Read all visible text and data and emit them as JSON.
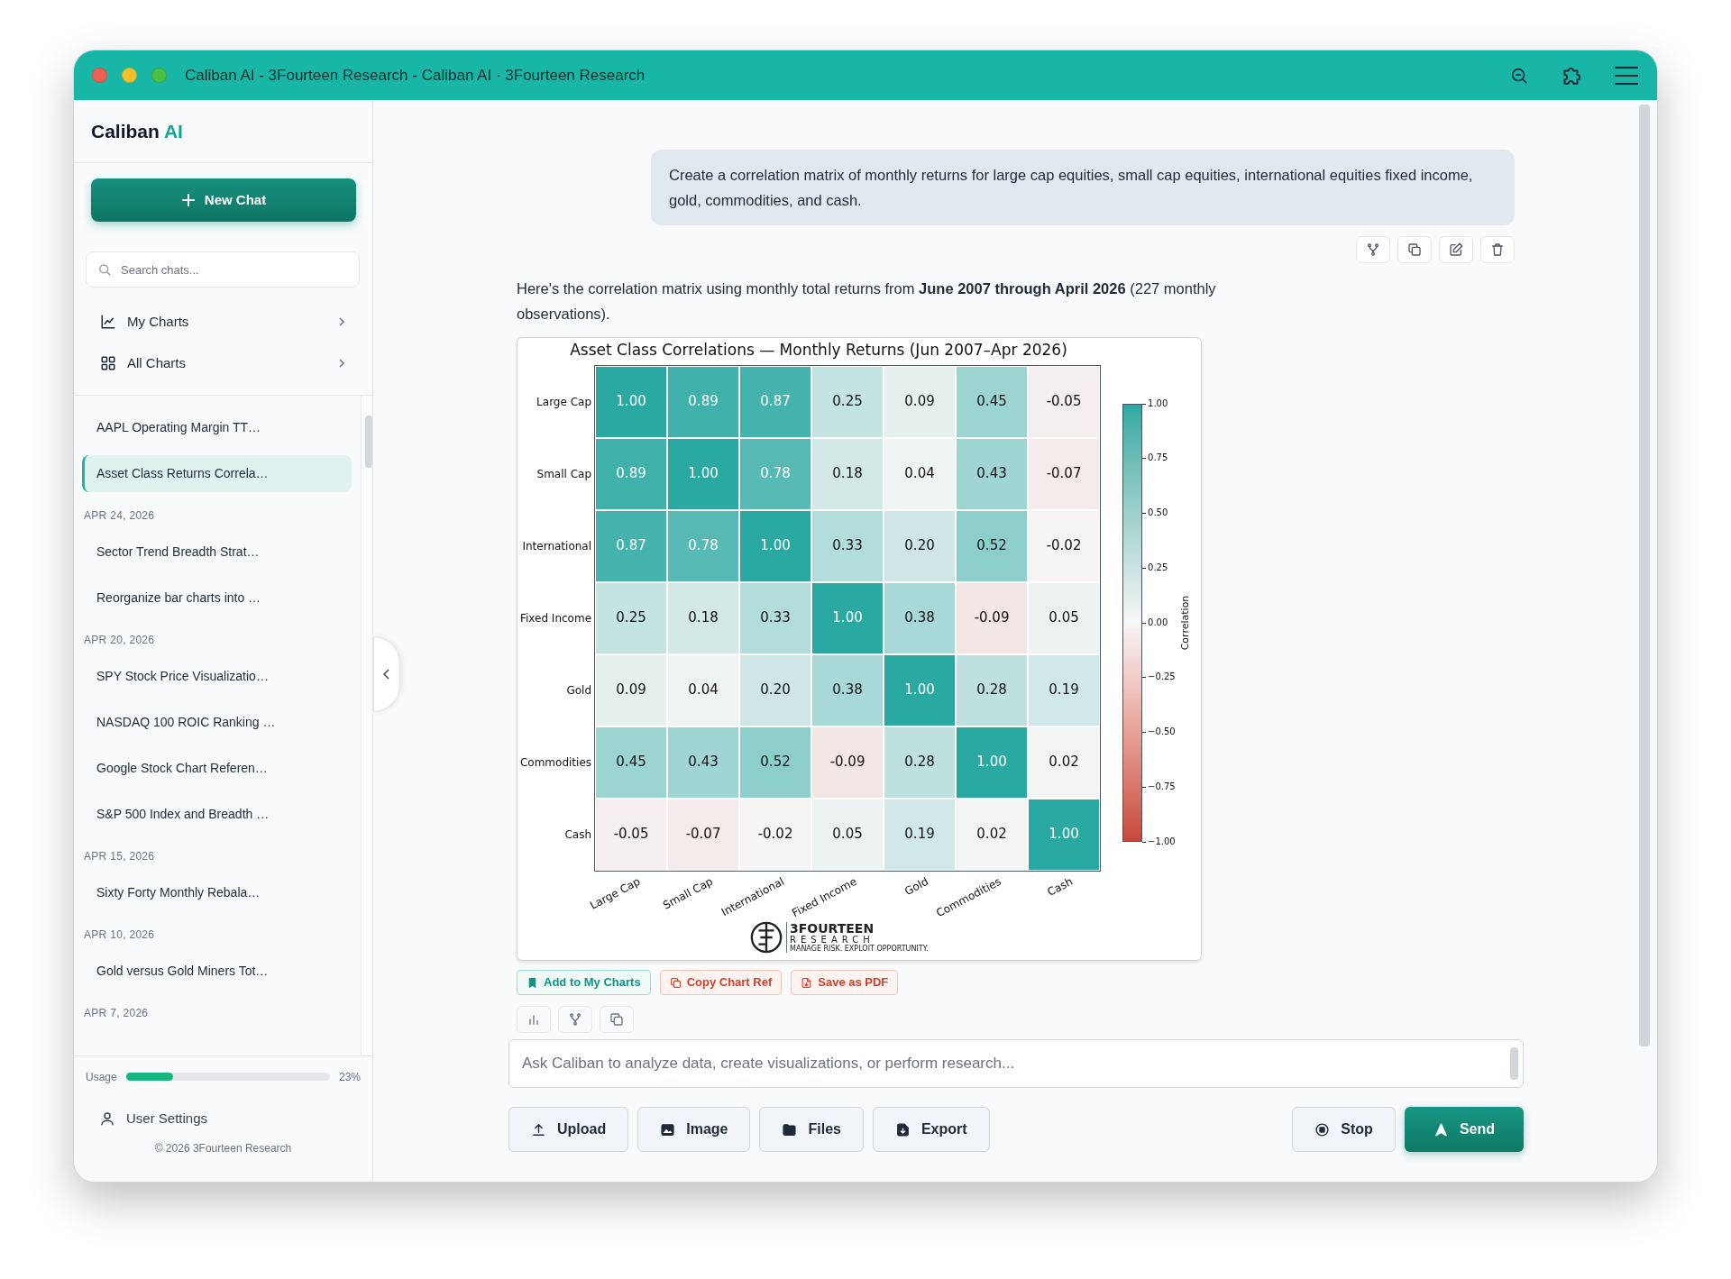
{
  "window": {
    "title": "Caliban AI - 3Fourteen Research - Caliban AI · 3Fourteen Research"
  },
  "sidebar": {
    "brand": "Caliban",
    "brand_accent": "AI",
    "new_chat": "New Chat",
    "search": {
      "placeholder": "Search chats..."
    },
    "nav": [
      {
        "label": "My Charts",
        "kind": "chart"
      },
      {
        "label": "All Charts",
        "kind": "grid"
      }
    ],
    "chat_groups": [
      {
        "items": [
          {
            "title": "AAPL Operating Margin TT…",
            "selected": false
          },
          {
            "title": "Asset Class Returns Correla…",
            "selected": true
          }
        ]
      },
      {
        "heading": "APR 24, 2026",
        "items": [
          {
            "title": "Sector Trend Breadth Strat…",
            "selected": false
          },
          {
            "title": "Reorganize bar charts into …",
            "selected": false
          }
        ]
      },
      {
        "heading": "APR 20, 2026",
        "items": [
          {
            "title": "SPY Stock Price Visualizatio…",
            "selected": false
          },
          {
            "title": "NASDAQ 100 ROIC Ranking …",
            "selected": false
          },
          {
            "title": "Google Stock Chart Referen…",
            "selected": false
          },
          {
            "title": "S&P 500 Index and Breadth …",
            "selected": false
          }
        ]
      },
      {
        "heading": "APR 15, 2026",
        "items": [
          {
            "title": "Sixty Forty Monthly Rebala…",
            "selected": false
          }
        ]
      },
      {
        "heading": "APR 10, 2026",
        "items": [
          {
            "title": "Gold versus Gold Miners Tot…",
            "selected": false
          }
        ]
      },
      {
        "heading": "APR 7, 2026"
      }
    ],
    "usage": {
      "label": "Usage",
      "level": 0.23,
      "reading": "23%"
    },
    "user_settings": "User Settings",
    "footer": "© 2026 3Fourteen Research"
  },
  "conversation": {
    "user_message": "Create a correlation matrix of monthly returns for large cap equities, small cap equities, international equities fixed income, gold, commodities, and cash.",
    "assistant_message": "Here's the correlation matrix using monthly total returns from **June 2007 through April 2026** (227 monthly observations).",
    "heatmap": {
      "title": "Asset Class Correlations — Monthly Returns (Jun 2007–Apr 2026)",
      "rows": [
        "Large Cap",
        "Small Cap",
        "International",
        "Fixed Income",
        "Gold",
        "Commodities",
        "Cash"
      ],
      "columns": [
        "Large Cap",
        "Small Cap",
        "International",
        "Fixed Income",
        "Gold",
        "Commodities",
        "Cash"
      ],
      "cells": [
        [
          "1.00",
          "0.89",
          "0.87",
          "0.25",
          "0.09",
          "0.45",
          "-0.05"
        ],
        [
          "0.89",
          "1.00",
          "0.78",
          "0.18",
          "0.04",
          "0.43",
          "-0.07"
        ],
        [
          "0.87",
          "0.78",
          "1.00",
          "0.33",
          "0.20",
          "0.52",
          "-0.02"
        ],
        [
          "0.25",
          "0.18",
          "0.33",
          "1.00",
          "0.38",
          "-0.09",
          "0.05"
        ],
        [
          "0.09",
          "0.04",
          "0.20",
          "0.38",
          "1.00",
          "0.28",
          "0.19"
        ],
        [
          "0.45",
          "0.43",
          "0.52",
          "-0.09",
          "0.28",
          "1.00",
          "0.02"
        ],
        [
          "-0.05",
          "-0.07",
          "-0.02",
          "0.05",
          "0.19",
          "0.02",
          "1.00"
        ]
      ],
      "colorbar": {
        "label": "Correlation",
        "ticks": [
          "1.00",
          "0.75",
          "0.50",
          "0.25",
          "0.00",
          "−0.25",
          "−0.50",
          "−0.75",
          "−1.00"
        ]
      },
      "logo": {
        "name": "3FOURTEEN",
        "sub": "RESEARCH",
        "tagline": "MANAGE RISK. EXPLOIT OPPORTUNITY."
      }
    },
    "chart_actions": [
      {
        "label": "Add to My Charts",
        "kind": "bookmark"
      },
      {
        "label": "Copy Chart Ref",
        "kind": "copy"
      },
      {
        "label": "Save as PDF",
        "kind": "pdf"
      }
    ]
  },
  "composer": {
    "placeholder": "Ask Caliban to analyze data, create visualizations, or perform research...",
    "buttons": [
      {
        "label": "Upload",
        "kind": "upload"
      },
      {
        "label": "Image",
        "kind": "image"
      },
      {
        "label": "Files",
        "kind": "files"
      },
      {
        "label": "Export",
        "kind": "export"
      },
      {
        "label": "Stop",
        "kind": "stop"
      },
      {
        "label": "Send",
        "kind": "send"
      }
    ]
  }
}
